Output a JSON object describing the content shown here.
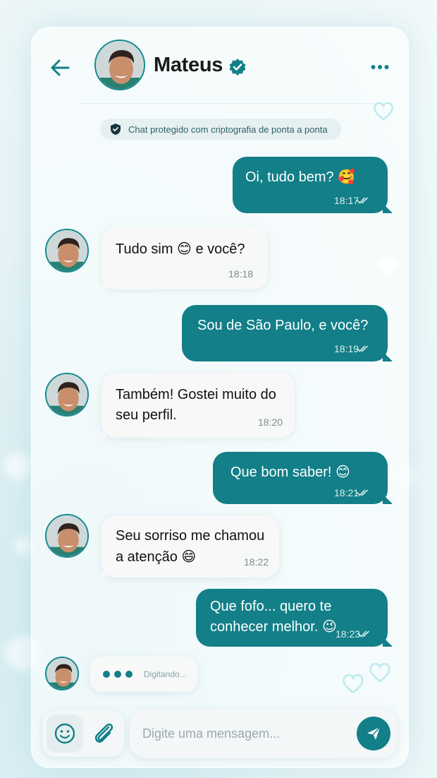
{
  "header": {
    "contact_name": "Mateus",
    "back_icon": "arrow-left-icon",
    "verified_icon": "verified-badge-icon",
    "more_icon": "more-dots-icon"
  },
  "security_notice": {
    "text": "Chat protegido com criptografia de ponta a ponta",
    "icon": "shield-icon"
  },
  "messages": [
    {
      "direction": "out",
      "text": "Oi, tudo bem? 🥰",
      "time": "18:17",
      "status": "read"
    },
    {
      "direction": "in",
      "text": "Tudo sim 😊 e você?",
      "time": "18:18"
    },
    {
      "direction": "out",
      "text": "Sou de São Paulo, e você?",
      "time": "18:19",
      "status": "read"
    },
    {
      "direction": "in",
      "line1": "Também! Gostei muito do",
      "line2": "seu perfil.",
      "time": "18:20"
    },
    {
      "direction": "out",
      "text": "Que bom saber! 😊",
      "time": "18:21",
      "status": "read"
    },
    {
      "direction": "in",
      "line1": "Seu sorriso me chamou",
      "line2": "a atenção 😄",
      "time": "18:22"
    },
    {
      "direction": "out",
      "line1": "Que fofo... quero te",
      "line2": "conhecer melhor. 😉",
      "time": "18:23",
      "status": "read"
    }
  ],
  "typing": {
    "label": "Digitando..."
  },
  "composer": {
    "placeholder": "Digite uma mensagem...",
    "emoji_icon": "smiley-icon",
    "attach_icon": "paperclip-icon",
    "send_icon": "send-icon"
  },
  "colors": {
    "accent": "#137f88",
    "incoming_bubble": "#f7f9f9",
    "background": "#e6f3f6"
  }
}
